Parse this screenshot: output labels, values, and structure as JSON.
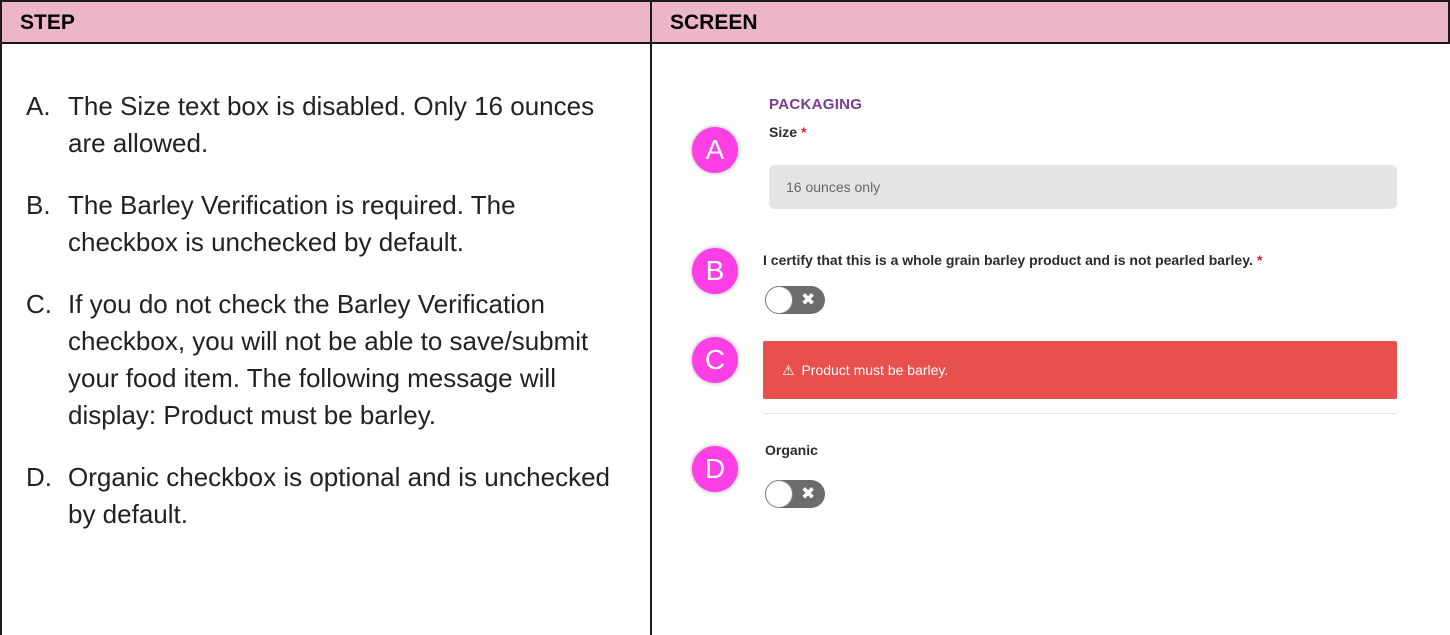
{
  "table": {
    "col_step_header": "STEP",
    "col_screen_header": "SCREEN"
  },
  "steps": [
    {
      "letter": "A.",
      "text": "The Size text box is disabled.  Only 16 ounces are allowed."
    },
    {
      "letter": "B.",
      "text": "The Barley Verification is required.  The checkbox is unchecked by default."
    },
    {
      "letter": "C.",
      "text": "If you do not check the Barley Verification checkbox, you will not be able to save/submit your food item.  The following message will display:  Product must be barley."
    },
    {
      "letter": "D.",
      "text": "Organic checkbox is optional and is unchecked by default."
    }
  ],
  "screen": {
    "section_title": "PACKAGING",
    "size_label": "Size",
    "required_mark": "*",
    "size_value": "16 ounces only",
    "certify_label": "I certify that this is a whole grain barley product and is not pearled barley.",
    "alert_icon": "⚠",
    "alert_text": "Product must be barley.",
    "organic_label": "Organic",
    "toggle_off_symbol": "✖",
    "markers": [
      "A",
      "B",
      "C",
      "D"
    ]
  },
  "colors": {
    "header_bg": "#ecb6c8",
    "section_title": "#7a3b92",
    "required": "#e0202a",
    "alert_bg": "#e8504e",
    "marker": "#ff3fe6",
    "toggle_off": "#6c6c6c"
  },
  "state": {
    "barley_certified": false,
    "organic": false,
    "size_disabled": true
  }
}
